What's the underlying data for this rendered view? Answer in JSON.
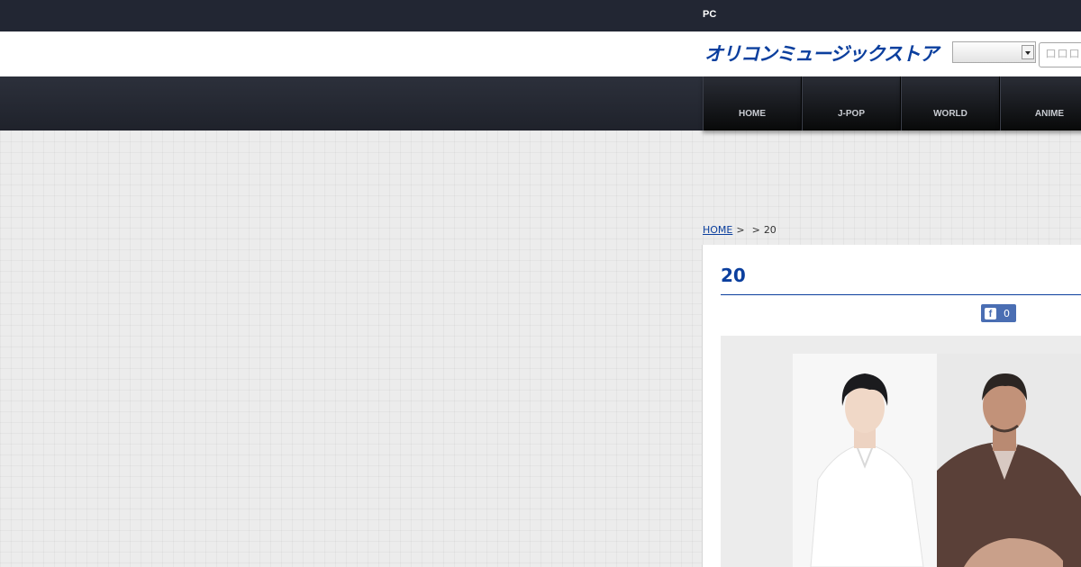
{
  "topbar": {
    "pc_label": "PC"
  },
  "header": {
    "logo_text": "オリコンミュージックストア",
    "select_value": "",
    "search_placeholder": "ロロロロロ"
  },
  "nav": {
    "items": [
      {
        "label": "HOME"
      },
      {
        "label": "J-POP"
      },
      {
        "label": "WORLD"
      },
      {
        "label": "ANIME"
      }
    ]
  },
  "breadcrumb": {
    "home": "HOME",
    "sep1": ">",
    "sep2": ">",
    "current": "20"
  },
  "article": {
    "title": "20",
    "fb_count": "0"
  },
  "colors": {
    "brand_blue": "#0b3f9e",
    "topbar": "#222633",
    "fb_blue": "#4a6eb3"
  }
}
